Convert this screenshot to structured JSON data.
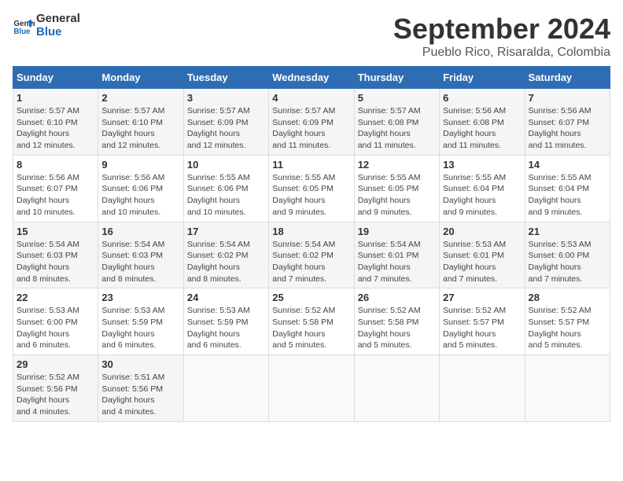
{
  "logo": {
    "line1": "General",
    "line2": "Blue"
  },
  "title": "September 2024",
  "subtitle": "Pueblo Rico, Risaralda, Colombia",
  "days_of_week": [
    "Sunday",
    "Monday",
    "Tuesday",
    "Wednesday",
    "Thursday",
    "Friday",
    "Saturday"
  ],
  "weeks": [
    [
      {
        "day": "1",
        "sunrise": "5:57 AM",
        "sunset": "6:10 PM",
        "daylight": "12 hours and 12 minutes."
      },
      {
        "day": "2",
        "sunrise": "5:57 AM",
        "sunset": "6:10 PM",
        "daylight": "12 hours and 12 minutes."
      },
      {
        "day": "3",
        "sunrise": "5:57 AM",
        "sunset": "6:09 PM",
        "daylight": "12 hours and 12 minutes."
      },
      {
        "day": "4",
        "sunrise": "5:57 AM",
        "sunset": "6:09 PM",
        "daylight": "12 hours and 11 minutes."
      },
      {
        "day": "5",
        "sunrise": "5:57 AM",
        "sunset": "6:08 PM",
        "daylight": "12 hours and 11 minutes."
      },
      {
        "day": "6",
        "sunrise": "5:56 AM",
        "sunset": "6:08 PM",
        "daylight": "12 hours and 11 minutes."
      },
      {
        "day": "7",
        "sunrise": "5:56 AM",
        "sunset": "6:07 PM",
        "daylight": "12 hours and 11 minutes."
      }
    ],
    [
      {
        "day": "8",
        "sunrise": "5:56 AM",
        "sunset": "6:07 PM",
        "daylight": "12 hours and 10 minutes."
      },
      {
        "day": "9",
        "sunrise": "5:56 AM",
        "sunset": "6:06 PM",
        "daylight": "12 hours and 10 minutes."
      },
      {
        "day": "10",
        "sunrise": "5:55 AM",
        "sunset": "6:06 PM",
        "daylight": "12 hours and 10 minutes."
      },
      {
        "day": "11",
        "sunrise": "5:55 AM",
        "sunset": "6:05 PM",
        "daylight": "12 hours and 9 minutes."
      },
      {
        "day": "12",
        "sunrise": "5:55 AM",
        "sunset": "6:05 PM",
        "daylight": "12 hours and 9 minutes."
      },
      {
        "day": "13",
        "sunrise": "5:55 AM",
        "sunset": "6:04 PM",
        "daylight": "12 hours and 9 minutes."
      },
      {
        "day": "14",
        "sunrise": "5:55 AM",
        "sunset": "6:04 PM",
        "daylight": "12 hours and 9 minutes."
      }
    ],
    [
      {
        "day": "15",
        "sunrise": "5:54 AM",
        "sunset": "6:03 PM",
        "daylight": "12 hours and 8 minutes."
      },
      {
        "day": "16",
        "sunrise": "5:54 AM",
        "sunset": "6:03 PM",
        "daylight": "12 hours and 8 minutes."
      },
      {
        "day": "17",
        "sunrise": "5:54 AM",
        "sunset": "6:02 PM",
        "daylight": "12 hours and 8 minutes."
      },
      {
        "day": "18",
        "sunrise": "5:54 AM",
        "sunset": "6:02 PM",
        "daylight": "12 hours and 7 minutes."
      },
      {
        "day": "19",
        "sunrise": "5:54 AM",
        "sunset": "6:01 PM",
        "daylight": "12 hours and 7 minutes."
      },
      {
        "day": "20",
        "sunrise": "5:53 AM",
        "sunset": "6:01 PM",
        "daylight": "12 hours and 7 minutes."
      },
      {
        "day": "21",
        "sunrise": "5:53 AM",
        "sunset": "6:00 PM",
        "daylight": "12 hours and 7 minutes."
      }
    ],
    [
      {
        "day": "22",
        "sunrise": "5:53 AM",
        "sunset": "6:00 PM",
        "daylight": "12 hours and 6 minutes."
      },
      {
        "day": "23",
        "sunrise": "5:53 AM",
        "sunset": "5:59 PM",
        "daylight": "12 hours and 6 minutes."
      },
      {
        "day": "24",
        "sunrise": "5:53 AM",
        "sunset": "5:59 PM",
        "daylight": "12 hours and 6 minutes."
      },
      {
        "day": "25",
        "sunrise": "5:52 AM",
        "sunset": "5:58 PM",
        "daylight": "12 hours and 5 minutes."
      },
      {
        "day": "26",
        "sunrise": "5:52 AM",
        "sunset": "5:58 PM",
        "daylight": "12 hours and 5 minutes."
      },
      {
        "day": "27",
        "sunrise": "5:52 AM",
        "sunset": "5:57 PM",
        "daylight": "12 hours and 5 minutes."
      },
      {
        "day": "28",
        "sunrise": "5:52 AM",
        "sunset": "5:57 PM",
        "daylight": "12 hours and 5 minutes."
      }
    ],
    [
      {
        "day": "29",
        "sunrise": "5:52 AM",
        "sunset": "5:56 PM",
        "daylight": "12 hours and 4 minutes."
      },
      {
        "day": "30",
        "sunrise": "5:51 AM",
        "sunset": "5:56 PM",
        "daylight": "12 hours and 4 minutes."
      },
      null,
      null,
      null,
      null,
      null
    ]
  ]
}
